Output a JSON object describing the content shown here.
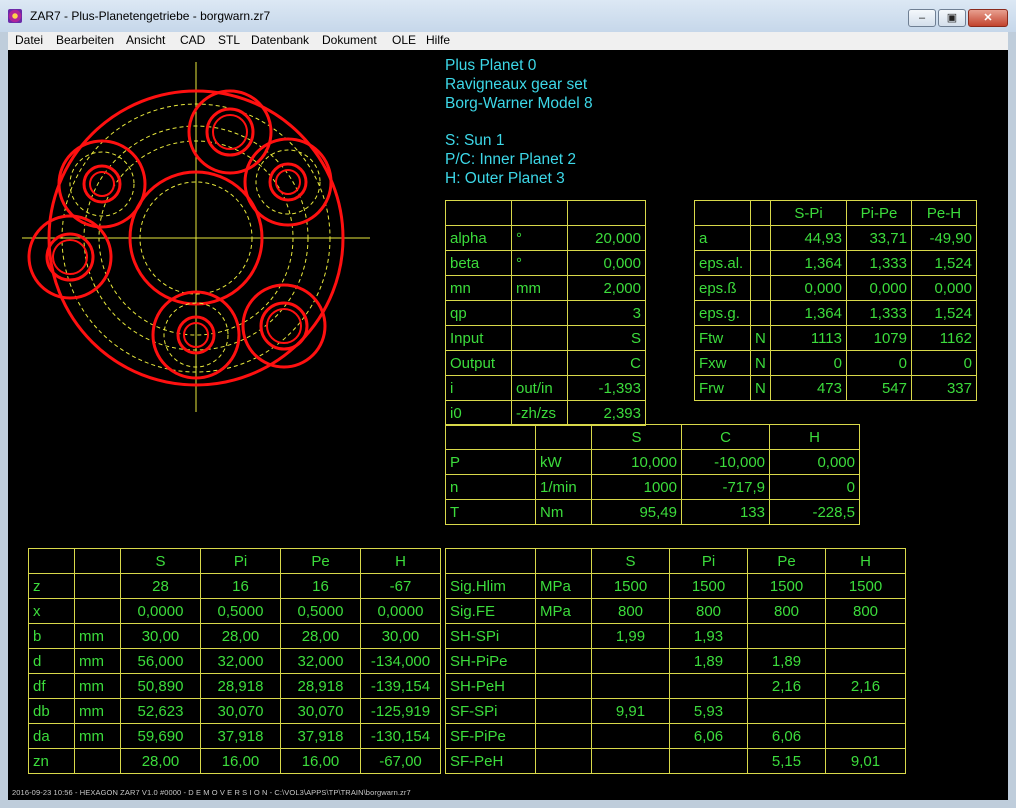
{
  "window": {
    "title": "ZAR7 - Plus-Planetengetriebe - borgwarn.zr7",
    "minimize": "‒",
    "maximize": "▣",
    "close": "✕"
  },
  "menu": [
    "Datei",
    "Bearbeiten",
    "Ansicht",
    "CAD",
    "STL",
    "Datenbank",
    "Dokument",
    "OLE",
    "Hilfe"
  ],
  "info": {
    "lines1": [
      "Plus Planet 0",
      "Ravigneaux gear set",
      "Borg-Warner Model 8"
    ],
    "lines2": [
      "S: Sun 1",
      "P/C: Inner Planet 2",
      "H: Outer Planet 3"
    ]
  },
  "table_params": {
    "rows": [
      [
        "",
        "",
        ""
      ],
      [
        "alpha",
        "°",
        "20,000"
      ],
      [
        "beta",
        "°",
        "0,000"
      ],
      [
        "mn",
        "mm",
        "2,000"
      ],
      [
        "qp",
        "",
        "3"
      ],
      [
        "Input",
        "",
        "S"
      ],
      [
        "Output",
        "",
        "C"
      ],
      [
        "i",
        "out/in",
        "-1,393"
      ],
      [
        "i0",
        "-zh/zs",
        "2,393"
      ]
    ]
  },
  "table_mesh": {
    "rows": [
      [
        "",
        "",
        "S-Pi",
        "Pi-Pe",
        "Pe-H"
      ],
      [
        "a",
        "",
        "44,93",
        "33,71",
        "-49,90"
      ],
      [
        "eps.al.",
        "",
        "1,364",
        "1,333",
        "1,524"
      ],
      [
        "eps.ß",
        "",
        "0,000",
        "0,000",
        "0,000"
      ],
      [
        "eps.g.",
        "",
        "1,364",
        "1,333",
        "1,524"
      ],
      [
        "Ftw",
        "N",
        "1113",
        "1079",
        "1162"
      ],
      [
        "Fxw",
        "N",
        "0",
        "0",
        "0"
      ],
      [
        "Frw",
        "N",
        "473",
        "547",
        "337"
      ]
    ]
  },
  "table_power": {
    "rows": [
      [
        "",
        "",
        "S",
        "C",
        "H"
      ],
      [
        "P",
        "kW",
        "10,000",
        "-10,000",
        "0,000"
      ],
      [
        "n",
        "1/min",
        "1000",
        "-717,9",
        "0"
      ],
      [
        "T",
        "Nm",
        "95,49",
        "133",
        "-228,5"
      ]
    ]
  },
  "table_geom": {
    "rows": [
      [
        "",
        "",
        "S",
        "Pi",
        "Pe",
        "H"
      ],
      [
        "z",
        "",
        "28",
        "16",
        "16",
        "-67"
      ],
      [
        "x",
        "",
        "0,0000",
        "0,5000",
        "0,5000",
        "0,0000"
      ],
      [
        "b",
        "mm",
        "30,00",
        "28,00",
        "28,00",
        "30,00"
      ],
      [
        "d",
        "mm",
        "56,000",
        "32,000",
        "32,000",
        "-134,000"
      ],
      [
        "df",
        "mm",
        "50,890",
        "28,918",
        "28,918",
        "-139,154"
      ],
      [
        "db",
        "mm",
        "52,623",
        "30,070",
        "30,070",
        "-125,919"
      ],
      [
        "da",
        "mm",
        "59,690",
        "37,918",
        "37,918",
        "-130,154"
      ],
      [
        "zn",
        "",
        "28,00",
        "16,00",
        "16,00",
        "-67,00"
      ]
    ]
  },
  "table_strength": {
    "rows": [
      [
        "",
        "",
        "S",
        "Pi",
        "Pe",
        "H"
      ],
      [
        "Sig.Hlim",
        "MPa",
        "1500",
        "1500",
        "1500",
        "1500"
      ],
      [
        "Sig.FE",
        "MPa",
        "800",
        "800",
        "800",
        "800"
      ],
      [
        "SH-SPi",
        "",
        "1,99",
        "1,93",
        "",
        ""
      ],
      [
        "SH-PiPe",
        "",
        "",
        "1,89",
        "1,89",
        ""
      ],
      [
        "SH-PeH",
        "",
        "",
        "",
        "2,16",
        "2,16"
      ],
      [
        "SF-SPi",
        "",
        "9,91",
        "5,93",
        "",
        ""
      ],
      [
        "SF-PiPe",
        "",
        "",
        "6,06",
        "6,06",
        ""
      ],
      [
        "SF-PeH",
        "",
        "",
        "",
        "5,15",
        "9,01"
      ]
    ]
  },
  "status": "2016-09-23 10:56 - HEXAGON ZAR7 V1.0 #0000 - D E M O V E R S I O N - C:\\VOL3\\APPS\\TP\\TRAIN\\borgwarn.zr7",
  "colors": {
    "gear": "#ff1010",
    "pitch": "#e8e83c",
    "axis": "#e8e83c",
    "text_cyan": "#3dd8e8",
    "cell_green": "#3cdc3c",
    "grid_yellow": "#d8d84a"
  }
}
